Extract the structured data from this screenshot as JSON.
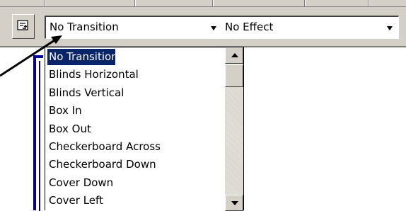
{
  "toolbar": {
    "slide_show_icon": "slide-transition-icon",
    "transition_combo": {
      "value": "No Transition"
    },
    "effect_combo": {
      "value": "No Effect"
    }
  },
  "transition_list": {
    "items": [
      {
        "label": "No Transition",
        "selected": true
      },
      {
        "label": "Blinds Horizontal"
      },
      {
        "label": "Blinds Vertical"
      },
      {
        "label": "Box In"
      },
      {
        "label": "Box Out"
      },
      {
        "label": "Checkerboard Across"
      },
      {
        "label": "Checkerboard Down"
      },
      {
        "label": "Cover Down"
      },
      {
        "label": "Cover Left"
      }
    ]
  },
  "colors": {
    "selection": "#0a246a",
    "face": "#d4d0c8",
    "annotation_arrow": "#000000"
  }
}
